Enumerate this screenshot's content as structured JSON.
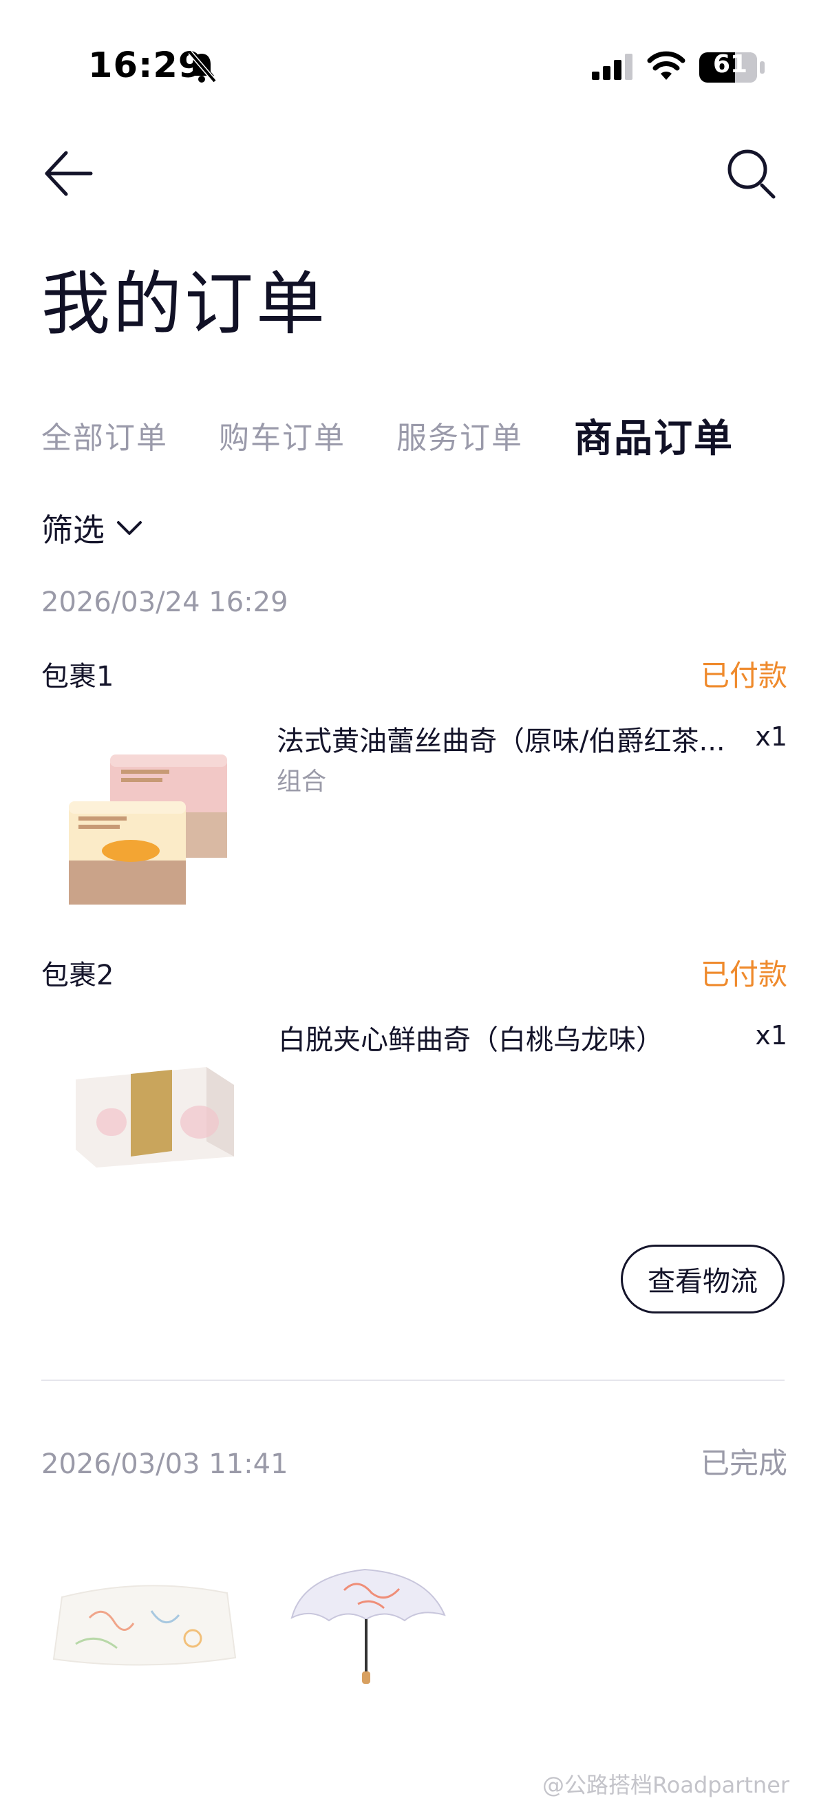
{
  "status_bar": {
    "time": "16:29",
    "battery": "61"
  },
  "header": {
    "title": "我的订单"
  },
  "tabs": [
    {
      "label": "全部订单",
      "active": false
    },
    {
      "label": "购车订单",
      "active": false
    },
    {
      "label": "服务订单",
      "active": false
    },
    {
      "label": "商品订单",
      "active": true
    }
  ],
  "filter": {
    "label": "筛选"
  },
  "orders": [
    {
      "timestamp": "2026/03/24 16:29",
      "packages": [
        {
          "label": "包裹1",
          "status": "已付款",
          "product_name": "法式黄油蕾丝曲奇（原味/伯爵红茶...",
          "variant": "组合",
          "qty": "x1"
        },
        {
          "label": "包裹2",
          "status": "已付款",
          "product_name": "白脱夹心鲜曲奇（白桃乌龙味）",
          "qty": "x1"
        }
      ],
      "action_label": "查看物流"
    },
    {
      "timestamp": "2026/03/03 11:41",
      "status": "已完成"
    }
  ],
  "watermark": "@公路搭档Roadpartner",
  "colors": {
    "accent_paid": "#ef8a2c",
    "text_primary": "#14142a",
    "text_muted": "#9a9aa8"
  }
}
